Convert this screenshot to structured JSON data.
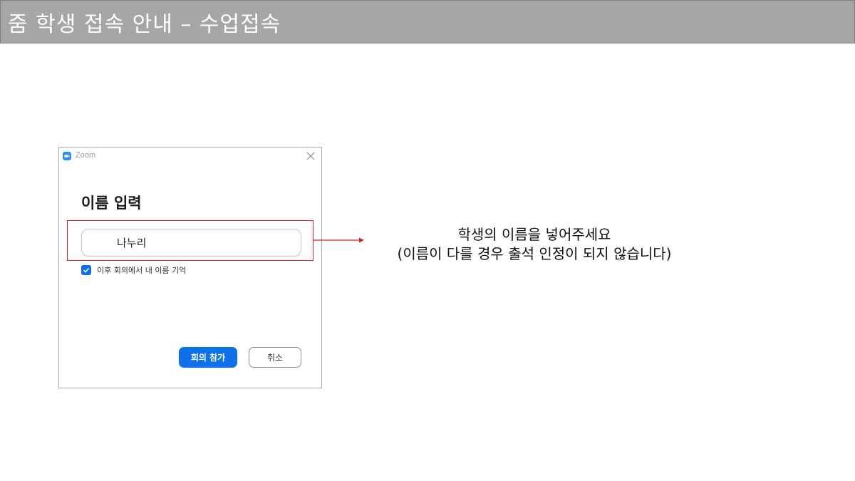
{
  "slide": {
    "title": "줌 학생 접속 안내 – 수업접속"
  },
  "window": {
    "app_name": "Zoom",
    "heading": "이름 입력",
    "name_value": "나누리",
    "remember_label": "이후 회의에서 내 이름 기억",
    "remember_checked": true,
    "join_label": "회의 참가",
    "cancel_label": "취소"
  },
  "annotation": {
    "line1": "학생의 이름을 넣어주세요",
    "line2": "(이름이 다를 경우 출석 인정이 되지 않습니다)",
    "color": "#e02020"
  },
  "colors": {
    "title_bar": "#a6a6a6",
    "accent": "#0e71eb"
  }
}
